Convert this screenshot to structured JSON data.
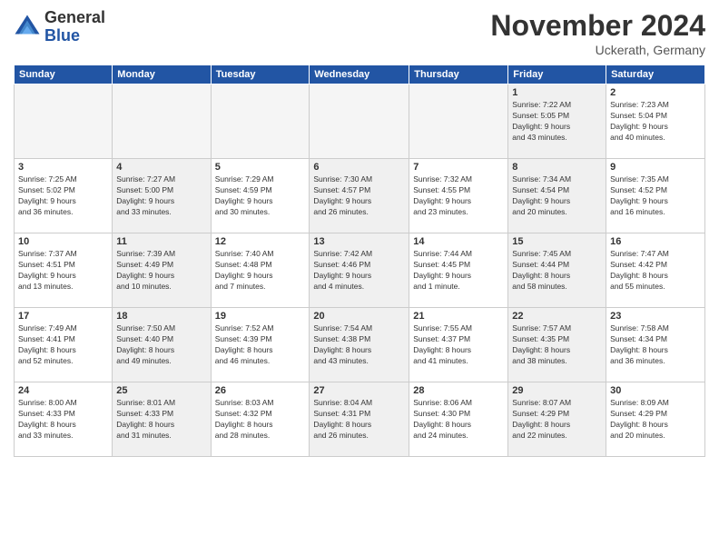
{
  "header": {
    "logo": {
      "general": "General",
      "blue": "Blue"
    },
    "title": "November 2024",
    "location": "Uckerath, Germany"
  },
  "weekdays": [
    "Sunday",
    "Monday",
    "Tuesday",
    "Wednesday",
    "Thursday",
    "Friday",
    "Saturday"
  ],
  "weeks": [
    [
      {
        "day": "",
        "info": "",
        "empty": true
      },
      {
        "day": "",
        "info": "",
        "empty": true
      },
      {
        "day": "",
        "info": "",
        "empty": true
      },
      {
        "day": "",
        "info": "",
        "empty": true
      },
      {
        "day": "",
        "info": "",
        "empty": true
      },
      {
        "day": "1",
        "info": "Sunrise: 7:22 AM\nSunset: 5:05 PM\nDaylight: 9 hours\nand 43 minutes.",
        "shaded": true
      },
      {
        "day": "2",
        "info": "Sunrise: 7:23 AM\nSunset: 5:04 PM\nDaylight: 9 hours\nand 40 minutes.",
        "shaded": false
      }
    ],
    [
      {
        "day": "3",
        "info": "Sunrise: 7:25 AM\nSunset: 5:02 PM\nDaylight: 9 hours\nand 36 minutes.",
        "shaded": false
      },
      {
        "day": "4",
        "info": "Sunrise: 7:27 AM\nSunset: 5:00 PM\nDaylight: 9 hours\nand 33 minutes.",
        "shaded": true
      },
      {
        "day": "5",
        "info": "Sunrise: 7:29 AM\nSunset: 4:59 PM\nDaylight: 9 hours\nand 30 minutes.",
        "shaded": false
      },
      {
        "day": "6",
        "info": "Sunrise: 7:30 AM\nSunset: 4:57 PM\nDaylight: 9 hours\nand 26 minutes.",
        "shaded": true
      },
      {
        "day": "7",
        "info": "Sunrise: 7:32 AM\nSunset: 4:55 PM\nDaylight: 9 hours\nand 23 minutes.",
        "shaded": false
      },
      {
        "day": "8",
        "info": "Sunrise: 7:34 AM\nSunset: 4:54 PM\nDaylight: 9 hours\nand 20 minutes.",
        "shaded": true
      },
      {
        "day": "9",
        "info": "Sunrise: 7:35 AM\nSunset: 4:52 PM\nDaylight: 9 hours\nand 16 minutes.",
        "shaded": false
      }
    ],
    [
      {
        "day": "10",
        "info": "Sunrise: 7:37 AM\nSunset: 4:51 PM\nDaylight: 9 hours\nand 13 minutes.",
        "shaded": false
      },
      {
        "day": "11",
        "info": "Sunrise: 7:39 AM\nSunset: 4:49 PM\nDaylight: 9 hours\nand 10 minutes.",
        "shaded": true
      },
      {
        "day": "12",
        "info": "Sunrise: 7:40 AM\nSunset: 4:48 PM\nDaylight: 9 hours\nand 7 minutes.",
        "shaded": false
      },
      {
        "day": "13",
        "info": "Sunrise: 7:42 AM\nSunset: 4:46 PM\nDaylight: 9 hours\nand 4 minutes.",
        "shaded": true
      },
      {
        "day": "14",
        "info": "Sunrise: 7:44 AM\nSunset: 4:45 PM\nDaylight: 9 hours\nand 1 minute.",
        "shaded": false
      },
      {
        "day": "15",
        "info": "Sunrise: 7:45 AM\nSunset: 4:44 PM\nDaylight: 8 hours\nand 58 minutes.",
        "shaded": true
      },
      {
        "day": "16",
        "info": "Sunrise: 7:47 AM\nSunset: 4:42 PM\nDaylight: 8 hours\nand 55 minutes.",
        "shaded": false
      }
    ],
    [
      {
        "day": "17",
        "info": "Sunrise: 7:49 AM\nSunset: 4:41 PM\nDaylight: 8 hours\nand 52 minutes.",
        "shaded": false
      },
      {
        "day": "18",
        "info": "Sunrise: 7:50 AM\nSunset: 4:40 PM\nDaylight: 8 hours\nand 49 minutes.",
        "shaded": true
      },
      {
        "day": "19",
        "info": "Sunrise: 7:52 AM\nSunset: 4:39 PM\nDaylight: 8 hours\nand 46 minutes.",
        "shaded": false
      },
      {
        "day": "20",
        "info": "Sunrise: 7:54 AM\nSunset: 4:38 PM\nDaylight: 8 hours\nand 43 minutes.",
        "shaded": true
      },
      {
        "day": "21",
        "info": "Sunrise: 7:55 AM\nSunset: 4:37 PM\nDaylight: 8 hours\nand 41 minutes.",
        "shaded": false
      },
      {
        "day": "22",
        "info": "Sunrise: 7:57 AM\nSunset: 4:35 PM\nDaylight: 8 hours\nand 38 minutes.",
        "shaded": true
      },
      {
        "day": "23",
        "info": "Sunrise: 7:58 AM\nSunset: 4:34 PM\nDaylight: 8 hours\nand 36 minutes.",
        "shaded": false
      }
    ],
    [
      {
        "day": "24",
        "info": "Sunrise: 8:00 AM\nSunset: 4:33 PM\nDaylight: 8 hours\nand 33 minutes.",
        "shaded": false
      },
      {
        "day": "25",
        "info": "Sunrise: 8:01 AM\nSunset: 4:33 PM\nDaylight: 8 hours\nand 31 minutes.",
        "shaded": true
      },
      {
        "day": "26",
        "info": "Sunrise: 8:03 AM\nSunset: 4:32 PM\nDaylight: 8 hours\nand 28 minutes.",
        "shaded": false
      },
      {
        "day": "27",
        "info": "Sunrise: 8:04 AM\nSunset: 4:31 PM\nDaylight: 8 hours\nand 26 minutes.",
        "shaded": true
      },
      {
        "day": "28",
        "info": "Sunrise: 8:06 AM\nSunset: 4:30 PM\nDaylight: 8 hours\nand 24 minutes.",
        "shaded": false
      },
      {
        "day": "29",
        "info": "Sunrise: 8:07 AM\nSunset: 4:29 PM\nDaylight: 8 hours\nand 22 minutes.",
        "shaded": true
      },
      {
        "day": "30",
        "info": "Sunrise: 8:09 AM\nSunset: 4:29 PM\nDaylight: 8 hours\nand 20 minutes.",
        "shaded": false
      }
    ]
  ]
}
